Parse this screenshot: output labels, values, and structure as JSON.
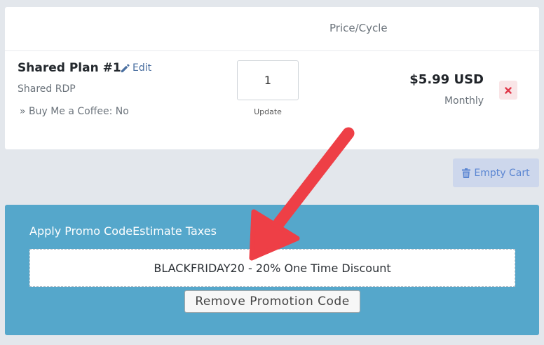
{
  "cart": {
    "header": {
      "price_cycle": "Price/Cycle"
    },
    "item": {
      "name": "Shared Plan #1",
      "edit_label": "Edit",
      "group": "Shared RDP",
      "option": "» Buy Me a Coffee: No",
      "quantity": "1",
      "update_label": "Update",
      "price": "$5.99 USD",
      "cycle": "Monthly"
    },
    "empty_cart_label": "Empty Cart"
  },
  "promo": {
    "tab_apply": "Apply Promo Code",
    "tab_taxes": "Estimate Taxes",
    "applied_code": "BLACKFRIDAY20 - 20% One Time Discount",
    "remove_label": "Remove Promotion Code"
  },
  "icons": {
    "edit": "pencil-icon",
    "remove": "x-icon",
    "empty_cart": "trash-icon"
  },
  "colors": {
    "promo_panel": "#55a7cb",
    "link": "#4a6fa0",
    "remove_x": "#e0394b",
    "empty_cart_text": "#5b86d2",
    "annotation_arrow": "#ee3f46"
  }
}
